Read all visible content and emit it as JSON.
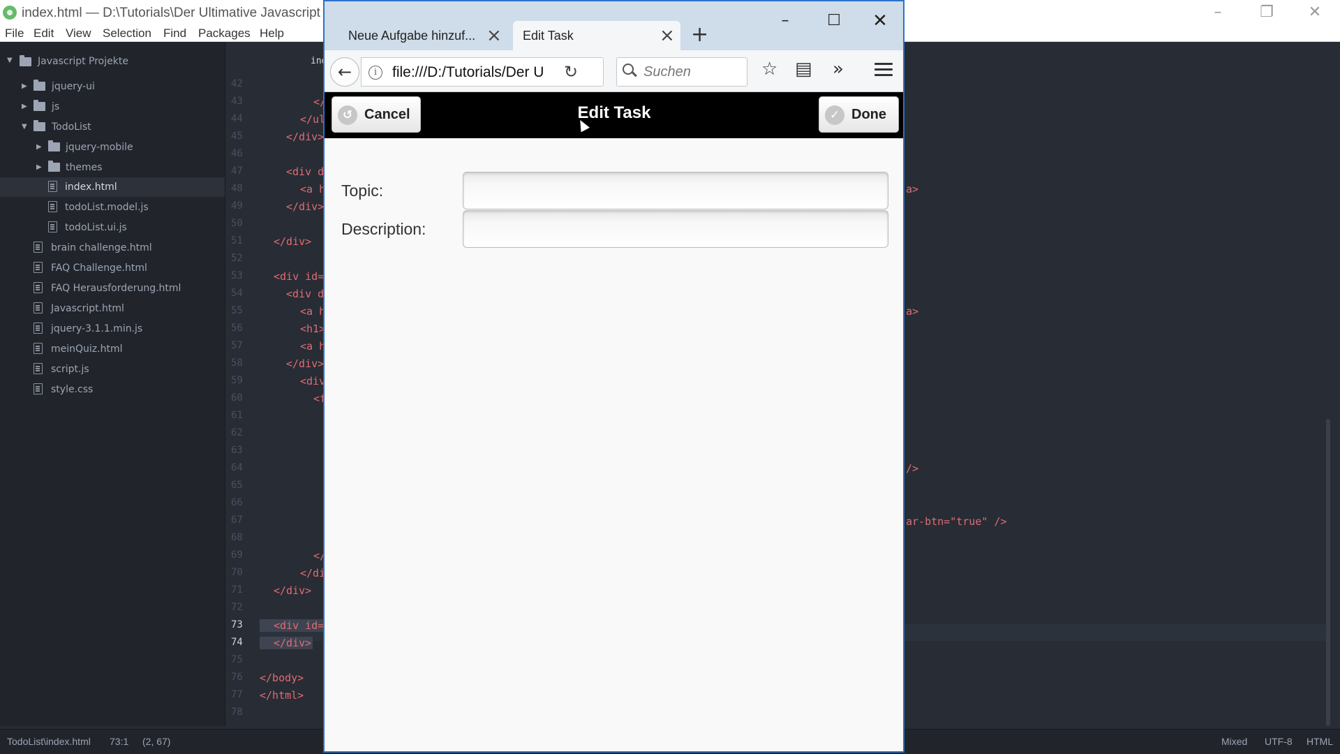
{
  "editor": {
    "title": "index.html — D:\\Tutorials\\Der Ultimative Javascript und",
    "menu": [
      "File",
      "Edit",
      "View",
      "Selection",
      "Find",
      "Packages",
      "Help"
    ],
    "tree": {
      "root": "Javascript Projekte",
      "items": [
        {
          "label": "jquery-ui",
          "type": "folder"
        },
        {
          "label": "js",
          "type": "folder"
        },
        {
          "label": "TodoList",
          "type": "folder"
        },
        {
          "label": "jquery-mobile",
          "type": "folder"
        },
        {
          "label": "themes",
          "type": "folder"
        },
        {
          "label": "index.html",
          "type": "file"
        },
        {
          "label": "todoList.model.js",
          "type": "file"
        },
        {
          "label": "todoList.ui.js",
          "type": "file"
        },
        {
          "label": "brain challenge.html",
          "type": "file"
        },
        {
          "label": "FAQ Challenge.html",
          "type": "file"
        },
        {
          "label": "FAQ Herausforderung.html",
          "type": "file"
        },
        {
          "label": "Javascript.html",
          "type": "file"
        },
        {
          "label": "jquery-3.1.1.min.js",
          "type": "file"
        },
        {
          "label": "meinQuiz.html",
          "type": "file"
        },
        {
          "label": "script.js",
          "type": "file"
        },
        {
          "label": "style.css",
          "type": "file"
        }
      ]
    },
    "tab_partial": "ind",
    "line_numbers": [
      "42",
      "43",
      "44",
      "45",
      "46",
      "47",
      "48",
      "49",
      "50",
      "51",
      "52",
      "53",
      "54",
      "55",
      "56",
      "57",
      "58",
      "59",
      "60",
      "61",
      "62",
      "63",
      "64",
      "65",
      "66",
      "67",
      "68",
      "69",
      "70",
      "71",
      "72",
      "73",
      "74",
      "75",
      "76",
      "77",
      "78"
    ],
    "current_line": "73",
    "code": {
      "l43": "</",
      "l44": "</ul",
      "l45": "</div>",
      "l47": "<div d",
      "l48": "<a h",
      "l49": "</div>",
      "l51": "</div>",
      "l53": "<div id=",
      "l54": "<div d",
      "l55": "<a h",
      "l56": "<h1>",
      "l57": "<a h",
      "l58": "</div>",
      "l59": "<div",
      "l60": "<f",
      "l69": "</",
      "l70": "</di",
      "l71": "</div>",
      "l73": "<div id=",
      "l74": "</div>",
      "l76": "</body>",
      "l77": "</html>",
      "r48": "a>",
      "r55": "a>",
      "r64": "/>",
      "r67": "ar-btn=\"true\" />"
    },
    "status": {
      "path": "TodoList\\index.html",
      "position": "73:1",
      "selection": "(2, 67)",
      "line_ending": "Mixed",
      "encoding": "UTF-8",
      "grammar": "HTML"
    }
  },
  "browser": {
    "tabs": [
      {
        "label": "Neue Aufgabe hinzuf..."
      },
      {
        "label": "Edit Task",
        "active": true
      }
    ],
    "url": "file:///D:/Tutorials/Der U",
    "search_placeholder": "Suchen",
    "page": {
      "header_title": "Edit Task",
      "cancel_label": "Cancel",
      "done_label": "Done",
      "topic_label": "Topic:",
      "description_label": "Description:",
      "topic_value": "",
      "description_value": ""
    }
  },
  "colors": {
    "editor_bg": "#282c34",
    "tree_bg": "#21252b",
    "browser_accent": "#2b73c8",
    "jqm_header": "#000000"
  }
}
